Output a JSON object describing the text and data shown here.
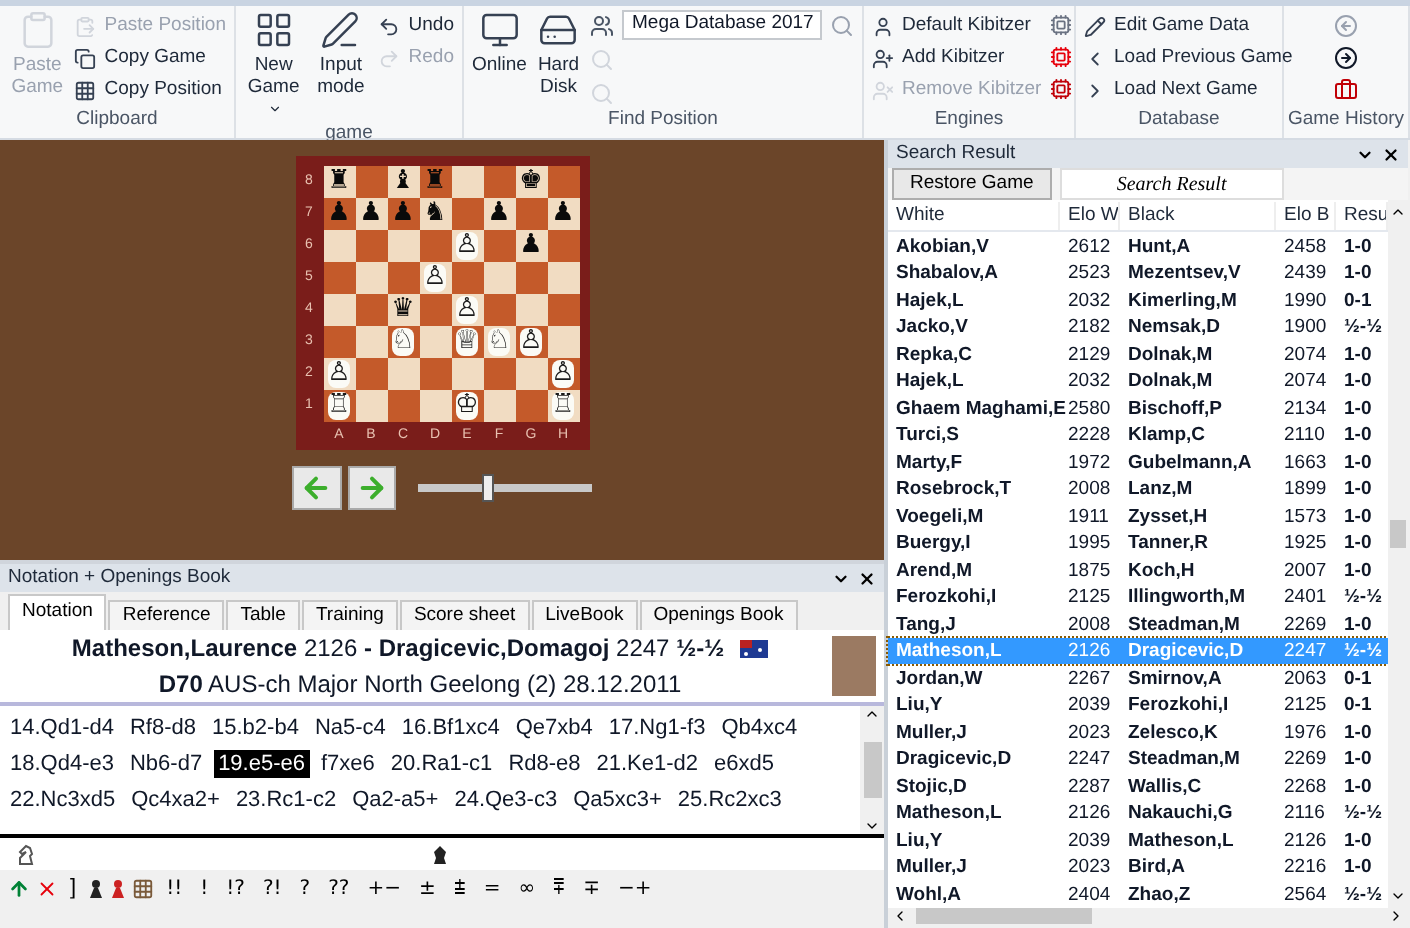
{
  "ribbon": {
    "groups": [
      {
        "label": "Clipboard",
        "big": [
          {
            "label": "Paste Game",
            "disabled": true
          }
        ],
        "small": [
          {
            "label": "Paste Position",
            "disabled": true
          },
          {
            "label": "Copy Game",
            "disabled": false
          },
          {
            "label": "Copy Position",
            "disabled": false
          }
        ]
      },
      {
        "label": "game",
        "big": [
          {
            "label": "New Game",
            "disabled": false
          },
          {
            "label": "Input mode",
            "disabled": false
          }
        ],
        "small": [
          {
            "label": "Undo",
            "disabled": false
          },
          {
            "label": "Redo",
            "disabled": true
          }
        ]
      },
      {
        "label": "Find Position",
        "big": [
          {
            "label": "Online",
            "disabled": false
          },
          {
            "label": "Hard Disk",
            "disabled": false
          }
        ],
        "database_select": {
          "value": "Mega Database 2017"
        }
      },
      {
        "label": "Engines",
        "small": [
          {
            "label": "Default Kibitzer",
            "disabled": false
          },
          {
            "label": "Add Kibitzer",
            "disabled": false
          },
          {
            "label": "Remove Kibitzer",
            "disabled": true
          }
        ]
      },
      {
        "label": "Database",
        "small": [
          {
            "label": "Edit Game Data",
            "disabled": false
          },
          {
            "label": "Load Previous Game",
            "disabled": false
          },
          {
            "label": "Load Next Game",
            "disabled": false
          }
        ]
      },
      {
        "label": "Game History"
      }
    ]
  },
  "board": {
    "files": [
      "A",
      "B",
      "C",
      "D",
      "E",
      "F",
      "G",
      "H"
    ],
    "ranks": [
      {
        "label": "8",
        "squares": [
          {
            "dark": false,
            "glyph": "♜",
            "white": false
          },
          {
            "dark": true
          },
          {
            "dark": false,
            "glyph": "♝",
            "white": false
          },
          {
            "dark": true,
            "glyph": "♜",
            "white": false
          },
          {
            "dark": false
          },
          {
            "dark": true
          },
          {
            "dark": false,
            "glyph": "♚",
            "white": false
          },
          {
            "dark": true
          }
        ]
      },
      {
        "label": "7",
        "squares": [
          {
            "dark": true,
            "glyph": "♟",
            "white": false
          },
          {
            "dark": false,
            "glyph": "♟",
            "white": false
          },
          {
            "dark": true,
            "glyph": "♟",
            "white": false
          },
          {
            "dark": false,
            "glyph": "♞",
            "white": false
          },
          {
            "dark": true
          },
          {
            "dark": false,
            "glyph": "♟",
            "white": false
          },
          {
            "dark": true
          },
          {
            "dark": false,
            "glyph": "♟",
            "white": false
          }
        ]
      },
      {
        "label": "6",
        "squares": [
          {
            "dark": false
          },
          {
            "dark": true
          },
          {
            "dark": false
          },
          {
            "dark": true
          },
          {
            "dark": false,
            "glyph": "♙",
            "white": true
          },
          {
            "dark": true
          },
          {
            "dark": false,
            "glyph": "♟",
            "white": false
          },
          {
            "dark": true
          }
        ]
      },
      {
        "label": "5",
        "squares": [
          {
            "dark": true
          },
          {
            "dark": false
          },
          {
            "dark": true
          },
          {
            "dark": false,
            "glyph": "♙",
            "white": true
          },
          {
            "dark": true
          },
          {
            "dark": false
          },
          {
            "dark": true
          },
          {
            "dark": false
          }
        ]
      },
      {
        "label": "4",
        "squares": [
          {
            "dark": false
          },
          {
            "dark": true
          },
          {
            "dark": false,
            "glyph": "♛",
            "white": false
          },
          {
            "dark": true
          },
          {
            "dark": false,
            "glyph": "♙",
            "white": true
          },
          {
            "dark": true
          },
          {
            "dark": false
          },
          {
            "dark": true
          }
        ]
      },
      {
        "label": "3",
        "squares": [
          {
            "dark": true
          },
          {
            "dark": false
          },
          {
            "dark": true,
            "glyph": "♘",
            "white": true
          },
          {
            "dark": false
          },
          {
            "dark": true,
            "glyph": "♕",
            "white": true
          },
          {
            "dark": false,
            "glyph": "♘",
            "white": true
          },
          {
            "dark": true,
            "glyph": "♙",
            "white": true
          },
          {
            "dark": false
          }
        ]
      },
      {
        "label": "2",
        "squares": [
          {
            "dark": false,
            "glyph": "♙",
            "white": true
          },
          {
            "dark": true
          },
          {
            "dark": false
          },
          {
            "dark": true
          },
          {
            "dark": false
          },
          {
            "dark": true
          },
          {
            "dark": false
          },
          {
            "dark": true,
            "glyph": "♙",
            "white": true
          }
        ]
      },
      {
        "label": "1",
        "squares": [
          {
            "dark": true,
            "glyph": "♖",
            "white": true
          },
          {
            "dark": false
          },
          {
            "dark": true
          },
          {
            "dark": false
          },
          {
            "dark": true,
            "glyph": "♔",
            "white": true
          },
          {
            "dark": false
          },
          {
            "dark": true
          },
          {
            "dark": false,
            "glyph": "♖",
            "white": true
          }
        ]
      }
    ],
    "slider": {
      "level": 0.4
    }
  },
  "notation": {
    "title": "Notation + Openings Book",
    "tabs": [
      {
        "label": "Notation",
        "selected": true
      },
      {
        "label": "Reference",
        "selected": false
      },
      {
        "label": "Table",
        "selected": false
      },
      {
        "label": "Training",
        "selected": false
      },
      {
        "label": "Score sheet",
        "selected": false
      },
      {
        "label": "LiveBook",
        "selected": false
      },
      {
        "label": "Openings Book",
        "selected": false
      }
    ],
    "game_header": [
      "**Matheson,Laurence** 2126 **- Dragicevic,Domagoj** 2247 **½-½**",
      "**D70** AUS-ch Major North Geelong (2) 28.12.2011"
    ],
    "moves": [
      {
        "text": "14.Qd1-d4",
        "selected": false
      },
      {
        "text": "Rf8-d8",
        "selected": false
      },
      {
        "text": "15.b2-b4",
        "selected": false
      },
      {
        "text": "Na5-c4",
        "selected": false
      },
      {
        "text": "16.Bf1xc4",
        "selected": false
      },
      {
        "text": "Qe7xb4",
        "selected": false
      },
      {
        "text": "17.Ng1-f3",
        "selected": false
      },
      {
        "text": "Qb4xc4",
        "selected": false
      },
      {
        "text": "18.Qd4-e3",
        "selected": false
      },
      {
        "text": "Nb6-d7",
        "selected": false
      },
      {
        "text": "19.e5-e6",
        "selected": true
      },
      {
        "text": "f7xe6",
        "selected": false
      },
      {
        "text": "20.Ra1-c1",
        "selected": false
      },
      {
        "text": "Rd8-e8",
        "selected": false
      },
      {
        "text": "21.Ke1-d2",
        "selected": false
      },
      {
        "text": "e6xd5",
        "selected": false
      },
      {
        "text": "22.Nc3xd5",
        "selected": false
      },
      {
        "text": "Qc4xa2+",
        "selected": false
      },
      {
        "text": "23.Rc1-c2",
        "selected": false
      },
      {
        "text": "Qa2-a5+",
        "selected": false
      },
      {
        "text": "24.Qe3-c3",
        "selected": false
      },
      {
        "text": "Qa5xc3+",
        "selected": false
      },
      {
        "text": "25.Rc2xc3",
        "selected": false
      }
    ],
    "symbols": [
      "]",
      "!!",
      "!",
      "!?",
      "?!",
      "?",
      "??",
      "+−",
      "±",
      "⩲",
      "=",
      "∞",
      "⩱",
      "∓",
      "−+"
    ]
  },
  "search_result": {
    "title": "Search Result",
    "restore_button": "Restore Game",
    "field": {
      "value": "Search Result"
    },
    "columns": [
      "White",
      "Elo W",
      "Black",
      "Elo B",
      "Resu"
    ],
    "rows": [
      {
        "cells": [
          "Akobian,V",
          "2612",
          "Hunt,A",
          "2458",
          "1-0"
        ],
        "selected": false
      },
      {
        "cells": [
          "Shabalov,A",
          "2523",
          "Mezentsev,V",
          "2439",
          "1-0"
        ],
        "selected": false
      },
      {
        "cells": [
          "Hajek,L",
          "2032",
          "Kimerling,M",
          "1990",
          "0-1"
        ],
        "selected": false
      },
      {
        "cells": [
          "Jacko,V",
          "2182",
          "Nemsak,D",
          "1900",
          "½-½"
        ],
        "selected": false
      },
      {
        "cells": [
          "Repka,C",
          "2129",
          "Dolnak,M",
          "2074",
          "1-0"
        ],
        "selected": false
      },
      {
        "cells": [
          "Hajek,L",
          "2032",
          "Dolnak,M",
          "2074",
          "1-0"
        ],
        "selected": false
      },
      {
        "cells": [
          "Ghaem Maghami,E",
          "2580",
          "Bischoff,P",
          "2134",
          "1-0"
        ],
        "selected": false
      },
      {
        "cells": [
          "Turci,S",
          "2228",
          "Klamp,C",
          "2110",
          "1-0"
        ],
        "selected": false
      },
      {
        "cells": [
          "Marty,F",
          "1972",
          "Gubelmann,A",
          "1663",
          "1-0"
        ],
        "selected": false
      },
      {
        "cells": [
          "Rosebrock,T",
          "2008",
          "Lanz,M",
          "1899",
          "1-0"
        ],
        "selected": false
      },
      {
        "cells": [
          "Voegeli,M",
          "1911",
          "Zysset,H",
          "1573",
          "1-0"
        ],
        "selected": false
      },
      {
        "cells": [
          "Buergy,I",
          "1995",
          "Tanner,R",
          "1925",
          "1-0"
        ],
        "selected": false
      },
      {
        "cells": [
          "Arend,M",
          "1875",
          "Koch,H",
          "2007",
          "1-0"
        ],
        "selected": false
      },
      {
        "cells": [
          "Ferozkohi,I",
          "2125",
          "Illingworth,M",
          "2401",
          "½-½"
        ],
        "selected": false
      },
      {
        "cells": [
          "Tang,J",
          "2008",
          "Steadman,M",
          "2269",
          "1-0"
        ],
        "selected": false
      },
      {
        "cells": [
          "Matheson,L",
          "2126",
          "Dragicevic,D",
          "2247",
          "½-½"
        ],
        "selected": true
      },
      {
        "cells": [
          "Jordan,W",
          "2267",
          "Smirnov,A",
          "2063",
          "0-1"
        ],
        "selected": false
      },
      {
        "cells": [
          "Liu,Y",
          "2039",
          "Ferozkohi,I",
          "2125",
          "0-1"
        ],
        "selected": false
      },
      {
        "cells": [
          "Muller,J",
          "2023",
          "Zelesco,K",
          "1976",
          "1-0"
        ],
        "selected": false
      },
      {
        "cells": [
          "Dragicevic,D",
          "2247",
          "Steadman,M",
          "2269",
          "1-0"
        ],
        "selected": false
      },
      {
        "cells": [
          "Stojic,D",
          "2287",
          "Wallis,C",
          "2268",
          "1-0"
        ],
        "selected": false
      },
      {
        "cells": [
          "Matheson,L",
          "2126",
          "Nakauchi,G",
          "2116",
          "½-½"
        ],
        "selected": false
      },
      {
        "cells": [
          "Liu,Y",
          "2039",
          "Matheson,L",
          "2126",
          "1-0"
        ],
        "selected": false
      },
      {
        "cells": [
          "Muller,J",
          "2023",
          "Bird,A",
          "2216",
          "1-0"
        ],
        "selected": false
      },
      {
        "cells": [
          "Wohl,A",
          "2404",
          "Zhao,Z",
          "2564",
          "½-½"
        ],
        "selected": false
      }
    ]
  }
}
